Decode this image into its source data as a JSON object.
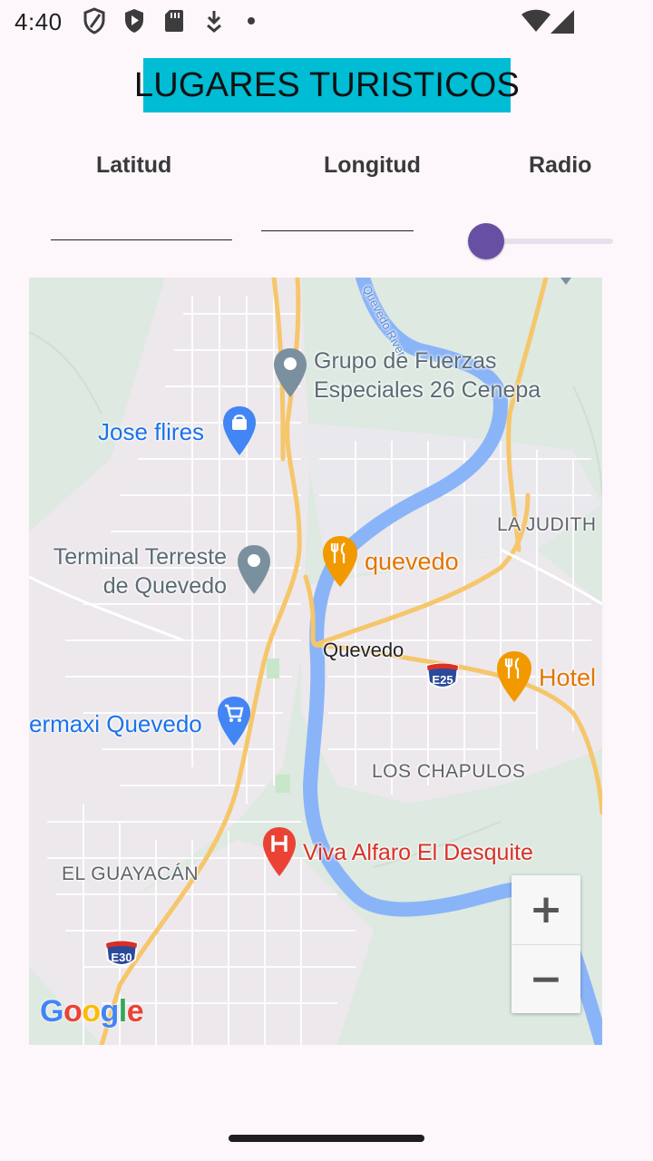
{
  "status_bar": {
    "time": "4:40",
    "icons": [
      "shield-icon",
      "play-protect-icon",
      "sd-card-icon",
      "download-icon",
      "dot-icon"
    ],
    "right_icons": [
      "wifi-icon",
      "signal-icon"
    ]
  },
  "header": {
    "title": "LUGARES TURISTICOS",
    "banner_color": "#00bcd4"
  },
  "form": {
    "latitude_label": "Latitud",
    "longitude_label": "Longitud",
    "radius_label": "Radio",
    "latitude_value": "",
    "longitude_value": "",
    "radius_fraction": 0,
    "accent_color": "#6750a4"
  },
  "map": {
    "places": {
      "grupo": "Grupo de Fuerzas\nEspeciales 26 Cenepa",
      "jose": "Jose flires",
      "terminal": "Terminal Terreste\nde Quevedo",
      "quevedo_food": "quevedo",
      "hotel": "Hotel",
      "supermaxi": "ermaxi Quevedo",
      "hospital": "Viva Alfaro El Desquite"
    },
    "areas": {
      "la_judith": "LA JUDITH",
      "los_chapulos": "LOS CHAPULOS",
      "el_guayacan": "EL GUAYACÁN"
    },
    "city": "Quevedo",
    "river": "Quevedo River",
    "highways": {
      "e25": "E25",
      "e30": "E30"
    },
    "zoom_in": "+",
    "zoom_out": "−",
    "logo": [
      "G",
      "o",
      "o",
      "g",
      "l",
      "e"
    ]
  }
}
